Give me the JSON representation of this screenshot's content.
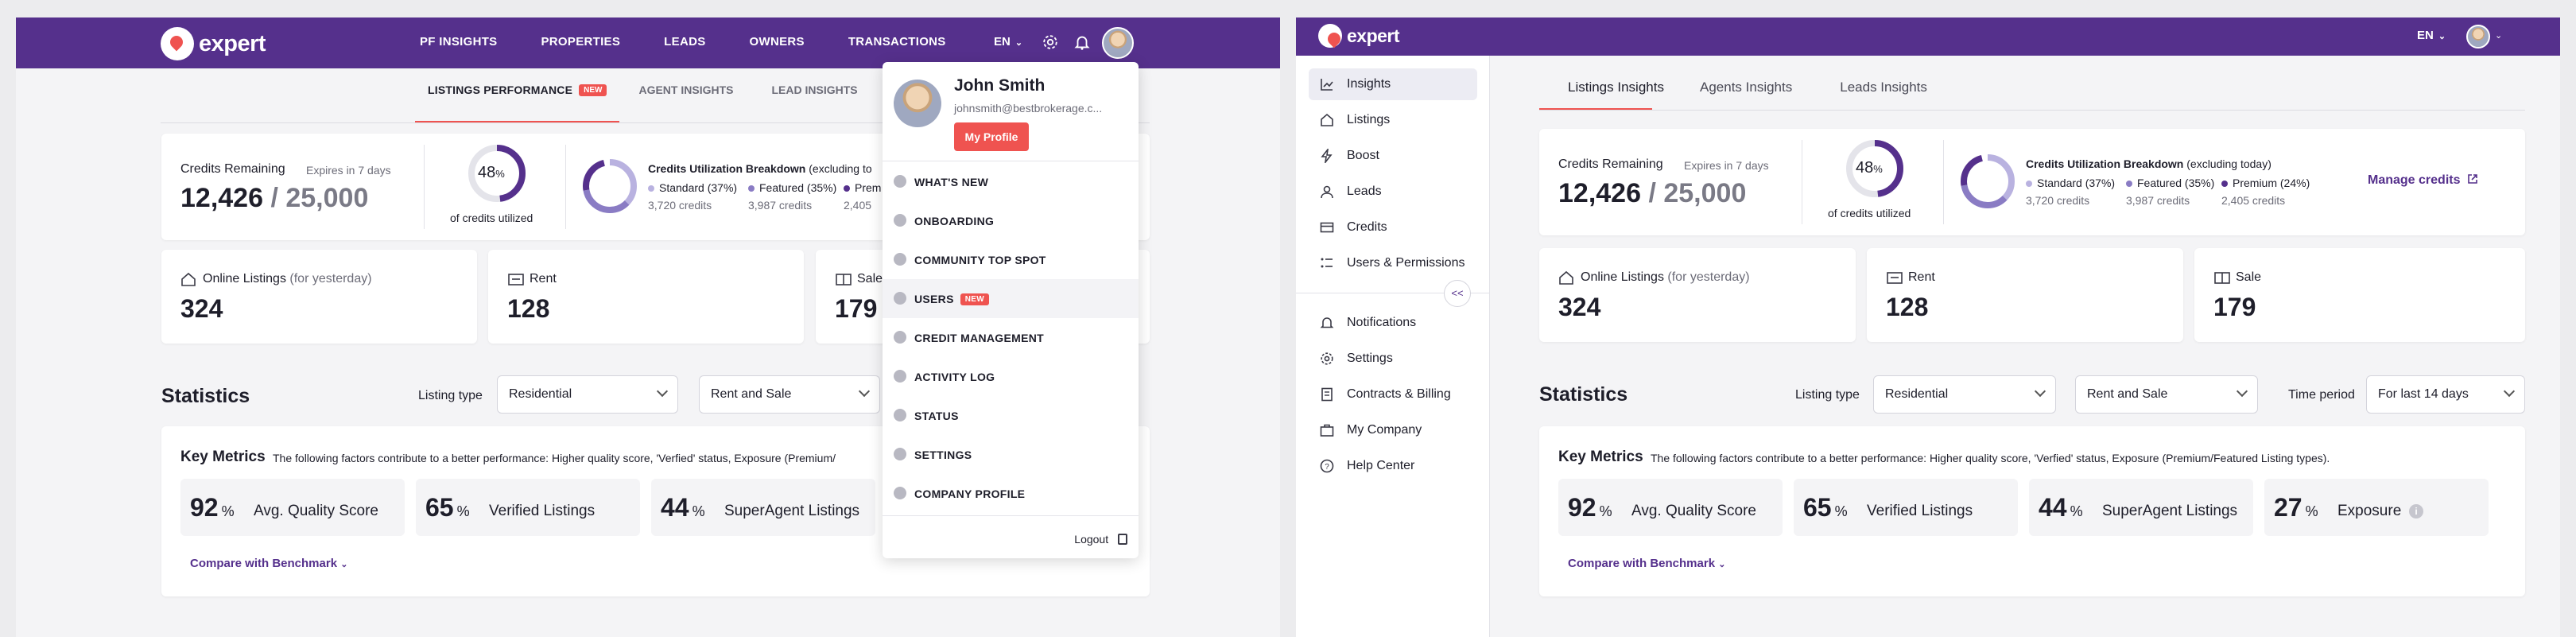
{
  "brand": {
    "name": "expert"
  },
  "left_panel": {
    "nav": [
      "PF INSIGHTS",
      "PROPERTIES",
      "LEADS",
      "OWNERS",
      "TRANSACTIONS"
    ],
    "lang": "EN",
    "tabs": [
      {
        "label": "LISTINGS PERFORMANCE",
        "badge": "NEW"
      },
      {
        "label": "AGENT INSIGHTS"
      },
      {
        "label": "LEAD INSIGHTS"
      }
    ],
    "credits": {
      "title": "Credits Remaining",
      "expires": "Expires in 7 days",
      "remaining": "12,426",
      "separator": "/",
      "total": "25,000",
      "percent": "48",
      "percent_unit": "%",
      "percent_value": 48,
      "utilized_label": "of credits utilized"
    },
    "breakdown": {
      "title": "Credits Utilization Breakdown",
      "suffix": "(excluding to",
      "standard": "Standard (37%)",
      "standard_credits": "3,720 credits",
      "featured": "Featured (35%)",
      "featured_credits": "3,987 credits",
      "premium": "Prem",
      "premium_credits": "2,405"
    },
    "listings": {
      "online_label": "Online Listings",
      "online_suffix": "(for yesterday)",
      "online_value": "324",
      "rent_label": "Rent",
      "rent_value": "128",
      "sale_label": "Sale",
      "sale_value": "179"
    },
    "statistics": {
      "title": "Statistics",
      "listing_type_label": "Listing type",
      "listing_type_value": "Residential",
      "rent_sale_value": "Rent and Sale"
    },
    "key_metrics": {
      "title": "Key Metrics",
      "desc": "The following factors contribute to a better performance: Higher quality score, 'Verfied' status, Exposure (Premium/",
      "m1_value": "92",
      "m1_label": "Avg. Quality Score",
      "m2_value": "65",
      "m2_label": "Verified Listings",
      "m3_value": "44",
      "m3_label": "SuperAgent Listings",
      "unit": "%",
      "benchmark": "Compare with Benchmark"
    }
  },
  "profile_menu": {
    "name": "John Smith",
    "email": "johnsmith@bestbrokerage.c...",
    "my_profile": "My Profile",
    "items": [
      "WHAT'S NEW",
      "ONBOARDING",
      "COMMUNITY TOP SPOT",
      "USERS",
      "CREDIT MANAGEMENT",
      "ACTIVITY LOG",
      "STATUS",
      "SETTINGS",
      "COMPANY PROFILE"
    ],
    "users_badge": "NEW",
    "logout": "Logout"
  },
  "right_panel": {
    "lang": "EN",
    "sidebar": [
      "Insights",
      "Listings",
      "Boost",
      "Leads",
      "Credits",
      "Users & Permissions",
      "Notifications",
      "Settings",
      "Contracts & Billing",
      "My Company",
      "Help Center"
    ],
    "collapse": "<<",
    "tabs": [
      "Listings Insights",
      "Agents Insights",
      "Leads Insights"
    ],
    "credits": {
      "title": "Credits Remaining",
      "expires": "Expires in 7 days",
      "remaining": "12,426",
      "separator": "/",
      "total": "25,000",
      "percent": "48",
      "percent_unit": "%",
      "utilized_label": "of credits utilized"
    },
    "breakdown": {
      "title": "Credits Utilization Breakdown",
      "suffix": "(excluding today)",
      "standard": "Standard (37%)",
      "standard_credits": "3,720 credits",
      "featured": "Featured (35%)",
      "featured_credits": "3,987 credits",
      "premium": "Premium (24%)",
      "premium_credits": "2,405 credits",
      "manage": "Manage credits"
    },
    "listings": {
      "online_label": "Online Listings",
      "online_suffix": "(for yesterday)",
      "online_value": "324",
      "rent_label": "Rent",
      "rent_value": "128",
      "sale_label": "Sale",
      "sale_value": "179"
    },
    "statistics": {
      "title": "Statistics",
      "listing_type_label": "Listing type",
      "listing_type_value": "Residential",
      "rent_sale_value": "Rent and Sale",
      "time_period_label": "Time period",
      "time_period_value": "For last 14 days"
    },
    "key_metrics": {
      "title": "Key Metrics",
      "desc": "The following factors contribute to a better performance: Higher quality score, 'Verfied' status, Exposure (Premium/Featured Listing types).",
      "m1_value": "92",
      "m1_label": "Avg. Quality Score",
      "m2_value": "65",
      "m2_label": "Verified Listings",
      "m3_value": "44",
      "m3_label": "SuperAgent Listings",
      "m4_value": "27",
      "m4_label": "Exposure",
      "unit": "%",
      "benchmark": "Compare with Benchmark"
    }
  },
  "colors": {
    "brand_purple": "#55308c",
    "accent_red": "#ef5350",
    "standard": "#b9b2e0",
    "featured": "#8a7cc4",
    "premium": "#55308c"
  },
  "icons": [
    "logo-icon",
    "settings-icon",
    "bell-icon",
    "home-icon",
    "rent-icon",
    "sale-icon",
    "chevron-down-icon",
    "external-link-icon",
    "info-icon",
    "logout-icon"
  ]
}
